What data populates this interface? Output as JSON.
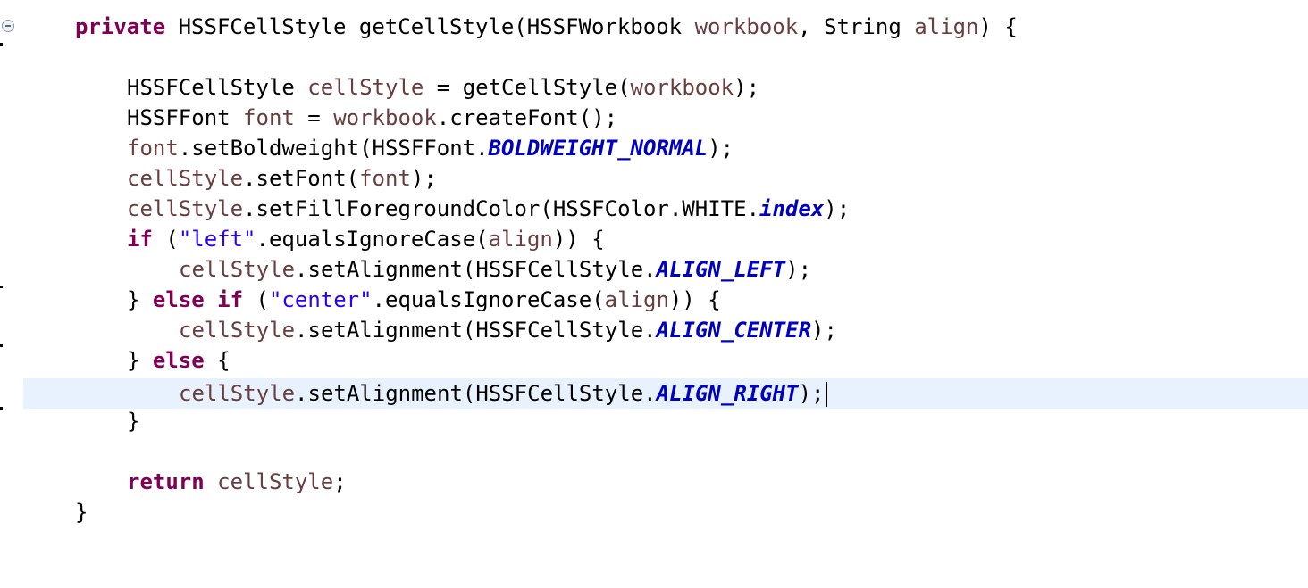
{
  "editor": {
    "lines": [
      {
        "tokens": [
          [
            "kw",
            "private"
          ],
          [
            "pl",
            " HSSFCellStyle getCellStyle(HSSFWorkbook "
          ],
          [
            "var",
            "workbook"
          ],
          [
            "pl",
            ", String "
          ],
          [
            "var",
            "align"
          ],
          [
            "pl",
            ") {"
          ]
        ]
      },
      {
        "tokens": [
          [
            "pl",
            "HSSFCellStyle "
          ],
          [
            "var",
            "cellStyle"
          ],
          [
            "pl",
            " = getCellStyle("
          ],
          [
            "var",
            "workbook"
          ],
          [
            "pl",
            ");"
          ]
        ]
      },
      {
        "tokens": [
          [
            "pl",
            "HSSFFont "
          ],
          [
            "var",
            "font"
          ],
          [
            "pl",
            " = "
          ],
          [
            "var",
            "workbook"
          ],
          [
            "pl",
            ".createFont();"
          ]
        ]
      },
      {
        "tokens": [
          [
            "var",
            "font"
          ],
          [
            "pl",
            ".setBoldweight(HSSFFont."
          ],
          [
            "const",
            "BOLDWEIGHT_NORMAL"
          ],
          [
            "pl",
            ");"
          ]
        ]
      },
      {
        "tokens": [
          [
            "var",
            "cellStyle"
          ],
          [
            "pl",
            ".setFont("
          ],
          [
            "var",
            "font"
          ],
          [
            "pl",
            ");"
          ]
        ]
      },
      {
        "tokens": [
          [
            "var",
            "cellStyle"
          ],
          [
            "pl",
            ".setFillForegroundColor(HSSFColor.WHITE."
          ],
          [
            "field",
            "index"
          ],
          [
            "pl",
            ");"
          ]
        ]
      },
      {
        "tokens": [
          [
            "kw",
            "if"
          ],
          [
            "pl",
            " ("
          ],
          [
            "str",
            "\"left\""
          ],
          [
            "pl",
            ".equalsIgnoreCase("
          ],
          [
            "var",
            "align"
          ],
          [
            "pl",
            ")) {"
          ]
        ]
      },
      {
        "tokens": [
          [
            "var",
            "cellStyle"
          ],
          [
            "pl",
            ".setAlignment(HSSFCellStyle."
          ],
          [
            "const",
            "ALIGN_LEFT"
          ],
          [
            "pl",
            ");"
          ]
        ]
      },
      {
        "tokens": [
          [
            "pl",
            "} "
          ],
          [
            "kw",
            "else if"
          ],
          [
            "pl",
            " ("
          ],
          [
            "str",
            "\"center\""
          ],
          [
            "pl",
            ".equalsIgnoreCase("
          ],
          [
            "var",
            "align"
          ],
          [
            "pl",
            ")) {"
          ]
        ]
      },
      {
        "tokens": [
          [
            "var",
            "cellStyle"
          ],
          [
            "pl",
            ".setAlignment(HSSFCellStyle."
          ],
          [
            "const",
            "ALIGN_CENTER"
          ],
          [
            "pl",
            ");"
          ]
        ]
      },
      {
        "tokens": [
          [
            "pl",
            "} "
          ],
          [
            "kw",
            "else"
          ],
          [
            "pl",
            " {"
          ]
        ]
      },
      {
        "tokens": [
          [
            "var",
            "cellStyle"
          ],
          [
            "pl",
            ".setAlignment(HSSFCellStyle."
          ],
          [
            "const",
            "ALIGN_RIGHT"
          ],
          [
            "pl",
            ");"
          ]
        ],
        "current": true
      },
      {
        "tokens": [
          [
            "pl",
            "}"
          ]
        ]
      },
      {
        "tokens": [
          [
            "kw",
            "return"
          ],
          [
            "pl",
            " "
          ],
          [
            "var",
            "cellStyle"
          ],
          [
            "pl",
            ";"
          ]
        ]
      },
      {
        "tokens": [
          [
            "pl",
            "}"
          ]
        ]
      }
    ]
  },
  "icons": {
    "fold": "fold-collapse-icon"
  }
}
